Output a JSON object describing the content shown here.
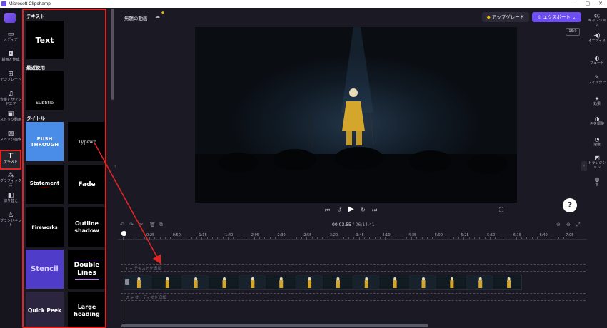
{
  "window": {
    "title": "Microsoft Clipchamp",
    "minimize": "—",
    "maximize": "▢",
    "close": "✕"
  },
  "left_rail": {
    "items": [
      {
        "label": "メディア",
        "icon": "folder-icon",
        "glyph": "▭"
      },
      {
        "label": "録画と作成",
        "icon": "camera-icon",
        "glyph": "◘"
      },
      {
        "label": "テンプレート",
        "icon": "templates-icon",
        "glyph": "⊞"
      },
      {
        "label": "音楽とサウンドエフ",
        "icon": "music-icon",
        "glyph": "♫"
      },
      {
        "label": "ストック動画",
        "icon": "stock-video-icon",
        "glyph": "▣"
      },
      {
        "label": "ストック画像",
        "icon": "stock-image-icon",
        "glyph": "▨"
      },
      {
        "label": "テキスト",
        "icon": "text-icon",
        "glyph": "T"
      },
      {
        "label": "グラフィックス",
        "icon": "graphics-icon",
        "glyph": "⁂"
      },
      {
        "label": "切り替え",
        "icon": "transitions-icon",
        "glyph": "◧"
      },
      {
        "label": "ブランドキット",
        "icon": "brand-kit-icon",
        "glyph": "♙"
      }
    ]
  },
  "text_panel": {
    "section_text": "テキスト",
    "section_recent": "最近使用",
    "section_title": "タイトル",
    "tiles": {
      "text": "Text",
      "subtitle": "Subtitle",
      "push_through": "PUSH THROUGH",
      "typewriter": "Typewr",
      "statement": "Statement",
      "fade": "Fade",
      "fireworks": "Fireworks",
      "outline_shadow": "Outline shadow",
      "stencil": "Stencil",
      "double_lines": "Double Lines",
      "quick_peek": "Quick Peek",
      "large_heading": "Large heading"
    }
  },
  "editor": {
    "project_title": "無題の動画",
    "upgrade_label": "アップグレード",
    "export_label": "エクスポート",
    "aspect_ratio": "16:9"
  },
  "timeline": {
    "current_time": "00:03.55",
    "duration": "/ 06:14.41",
    "ticks": [
      "0:25",
      "0:50",
      "1:15",
      "1:40",
      "2:05",
      "2:30",
      "2:55",
      "3:20",
      "3:45",
      "4:10",
      "4:35",
      "5:00",
      "5:25",
      "5:50",
      "6:15",
      "6:40",
      "7:05"
    ],
    "text_track_label": "T  + テキストを追加",
    "audio_track_label": "♫  + オーディオを追加"
  },
  "right_rail": {
    "items": [
      {
        "label": "キャプション",
        "icon": "captions-icon",
        "glyph": "㏄"
      },
      {
        "label": "オーディオ",
        "icon": "audio-icon",
        "glyph": "◀)"
      },
      {
        "label": "フェード",
        "icon": "fade-icon",
        "glyph": "◐"
      },
      {
        "label": "フィルター",
        "icon": "filters-icon",
        "glyph": "✎"
      },
      {
        "label": "効果",
        "icon": "effects-icon",
        "glyph": "✦"
      },
      {
        "label": "色を調整",
        "icon": "color-adjust-icon",
        "glyph": "◑"
      },
      {
        "label": "速度",
        "icon": "speed-icon",
        "glyph": "◔"
      },
      {
        "label": "トランジション",
        "icon": "transition-icon",
        "glyph": "◩"
      },
      {
        "label": "色",
        "icon": "color-icon",
        "glyph": "◍"
      }
    ]
  },
  "colors": {
    "accent": "#6c4ef2",
    "annotation": "#e02424",
    "background": "#1b1a24",
    "title_stage": "#d4a72c"
  }
}
